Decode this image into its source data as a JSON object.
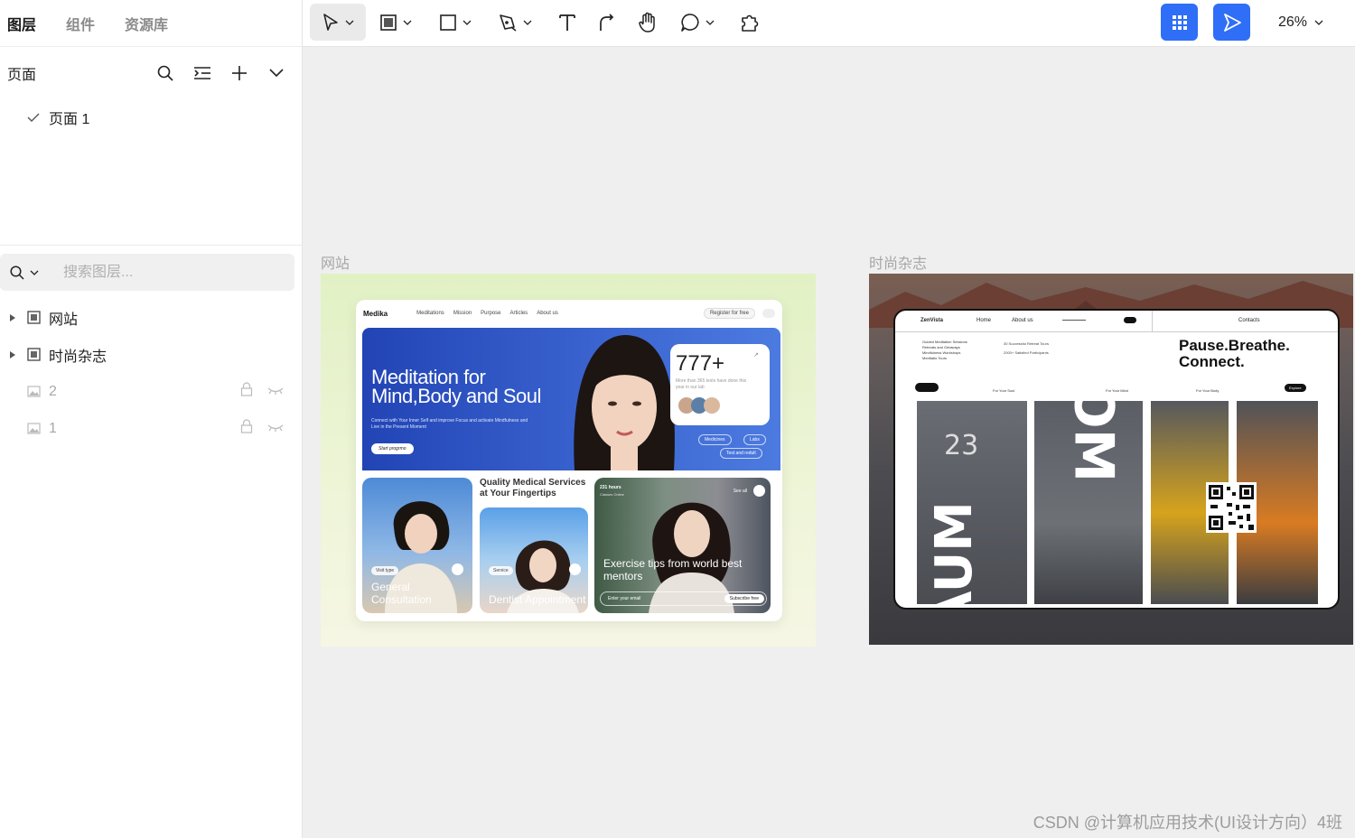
{
  "left_panel": {
    "tabs": [
      "图层",
      "组件",
      "资源库"
    ],
    "pages_title": "页面",
    "pages": [
      "页面 1"
    ],
    "search_placeholder": "搜索图层...",
    "layers": [
      {
        "name": "网站",
        "kind": "frame"
      },
      {
        "name": "时尚杂志",
        "kind": "frame"
      },
      {
        "name": "2",
        "kind": "image"
      },
      {
        "name": "1",
        "kind": "image"
      }
    ]
  },
  "toolbar": {
    "tools": [
      "select",
      "frame",
      "rectangle",
      "pen",
      "text",
      "connector",
      "hand",
      "comment",
      "plugins"
    ],
    "zoom": "26%",
    "accent": "#2f6ef7"
  },
  "canvas": {
    "frames": [
      {
        "label": "网站",
        "nav": {
          "brand": "Medika",
          "links": [
            "Meditations",
            "Mission",
            "Purpose",
            "Articles",
            "About us"
          ],
          "register": "Register for free"
        },
        "hero": {
          "title": "Meditation for Mind,Body and Soul",
          "subtitle": "Connect with Your Inner Self and improve Focus and activate Mindfulness and Live in the Present Moment",
          "cta": "Start progrmo",
          "stat_number": "777+",
          "stat_text": "More than 365 tests have done this year in our lab",
          "chips": [
            "Medicines",
            "Labs",
            "Test and redult"
          ]
        },
        "tiles": {
          "quality_title": "Quality Medical Services at Your Fingertips",
          "tile1_pill": "Visit type",
          "tile1_label": "General Consultation",
          "tile2_pill": "Service",
          "tile2_label": "Dentist Appointment",
          "tile3_hours": "231 hours",
          "tile3_online": "Classes Online",
          "tile3_see": "See all",
          "tile3_label": "Exercise tips from world best mentors",
          "tile3_email": "Enter your email",
          "tile3_subscribe": "Subscribe free"
        }
      },
      {
        "label": "时尚杂志",
        "nav": {
          "brand": "ZenVista",
          "links": [
            "Home",
            "About us"
          ],
          "contacts": "Contacts"
        },
        "bullets": [
          "Guided Meditation Sessions",
          "Retreats and Getaways",
          "Mindfulness Workshops",
          "Meditatio Tours"
        ],
        "stats": [
          "30 Successful Retreat Tours",
          "2000+ Satisfied Participants"
        ],
        "headline": "Pause.Breathe. Connect.",
        "small_links": [
          "For Your Soul",
          "For Your Mind",
          "For Your Body"
        ],
        "explore": "Explore",
        "big_letters": {
          "left": "AUM",
          "center": "OM",
          "number": "23"
        }
      }
    ]
  },
  "watermark": "CSDN @计算机应用技术(UI设计方向）4班"
}
